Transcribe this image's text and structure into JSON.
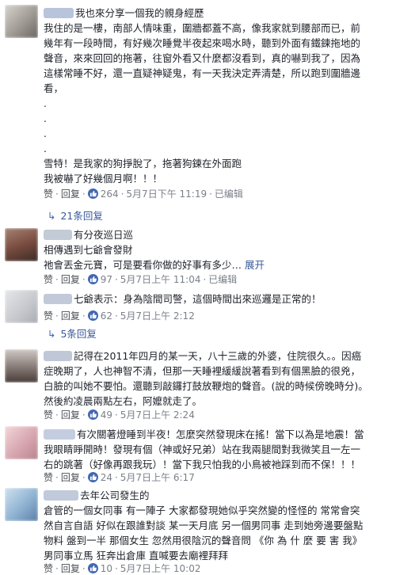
{
  "comments": [
    {
      "lines": [
        "我也來分享一個我的親身經歷",
        "我住的是一樓，南部人情味重，圍牆都蓋不高，像我家就到腰部而已，前",
        "幾年有一段時間，有好幾次睡覺半夜起來喝水時，聽到外面有鐵鍊拖地的",
        "聲音，來來回回的拖著，往窗外看又什麼都沒看到，真的嚇到我了，因為",
        "這樣常睡不好，還一直疑神疑鬼，有一天我決定弄清楚，所以跑到圍牆邊",
        "看，",
        ".",
        ".",
        ".",
        ".",
        "雪特！是我家的狗掙脫了，拖著狗鍊在外面跑",
        "我被嚇了好幾個月啊！！！"
      ],
      "like_label": "赞",
      "reply_label": "回复",
      "like_count": "264",
      "time": "5月7日下午 11:19",
      "edited": "已编辑",
      "replies_toggle": "21条回复"
    },
    {
      "lines": [
        "有分夜巡日巡",
        "相傳遇到七爺會發財",
        "祂會丟金元寶，可是要看你做的好事有多少…"
      ],
      "expand_label": "展开",
      "like_label": "赞",
      "reply_label": "回复",
      "like_count": "97",
      "time": "5月7日上午 11:04",
      "edited": "已编辑"
    },
    {
      "lines": [
        "七爺表示：身為陰間司警，這個時間出來巡邏是正常的！"
      ],
      "like_label": "赞",
      "reply_label": "回复",
      "like_count": "62",
      "time": "5月7日上午 2:12",
      "replies_toggle": "5条回复"
    },
    {
      "lines": [
        "記得在2011年四月的某一天，八十三歲的外婆，住院很久。。因癌",
        "症晚期了，人也神智不清，但那一天睡裡緩緩說著看到有個黑臉的很兇，",
        "白臉的叫她不要怕。還聽到敲鑼打鼓放鞭炮的聲音。(說的時候傍晚時分)。",
        "然後約凌晨兩點左右，阿嬤就走了。"
      ],
      "like_label": "赞",
      "reply_label": "回复",
      "like_count": "49",
      "time": "5月7日上午 2:24"
    },
    {
      "lines": [
        "有次關著燈睡到半夜！怎麼突然發現床在搖！當下以為是地震！當",
        "我眼睛睜開時！發現有個（神或好兄弟）站在我兩腿間對我微笑且一左一",
        "右的跳著（好像再跟我玩）！當下我只怕我的小鳥被祂踩到而不保！！！"
      ],
      "like_label": "赞",
      "reply_label": "回复",
      "like_count": "24",
      "time": "5月7日上午 6:17"
    },
    {
      "lines": [
        "去年公司發生的",
        "倉管的一個女同事 有一陣子 大家都發現她似乎突然變的怪怪的 常常會突",
        "然自言自語 好似在跟誰對談 某一天月底 另一個男同事 走到她旁邊要盤點",
        "物料 盤到一半 那個女生 忽然用很陰沉的聲音問 《你 為 什 麼 要 害 我》",
        "男同事立馬 狂奔出倉庫 直喊要去廟裡拜拜"
      ],
      "like_label": "赞",
      "reply_label": "回复",
      "like_count": "10",
      "time": "5月7日上午 10:02"
    }
  ],
  "colors": {
    "link": "#385898",
    "meta": "#7b8089",
    "like_badge": "#4267b2"
  }
}
